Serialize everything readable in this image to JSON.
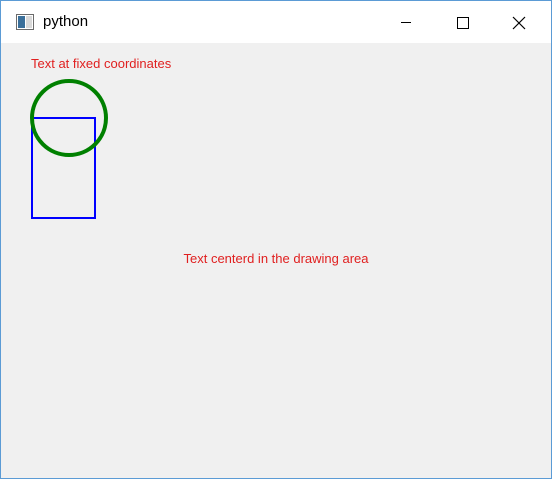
{
  "window": {
    "title": "python",
    "icon": "window-app-icon",
    "controls": {
      "minimize_icon": "minimize-icon",
      "maximize_icon": "maximize-icon",
      "close_icon": "close-icon"
    }
  },
  "canvas": {
    "fixed_text": "Text at fixed coordinates",
    "centered_text": "Text centerd in the drawing area",
    "colors": {
      "text": "#e02020",
      "circle": "#008000",
      "rectangle": "#0000ff",
      "background": "#f0f0f0"
    }
  }
}
